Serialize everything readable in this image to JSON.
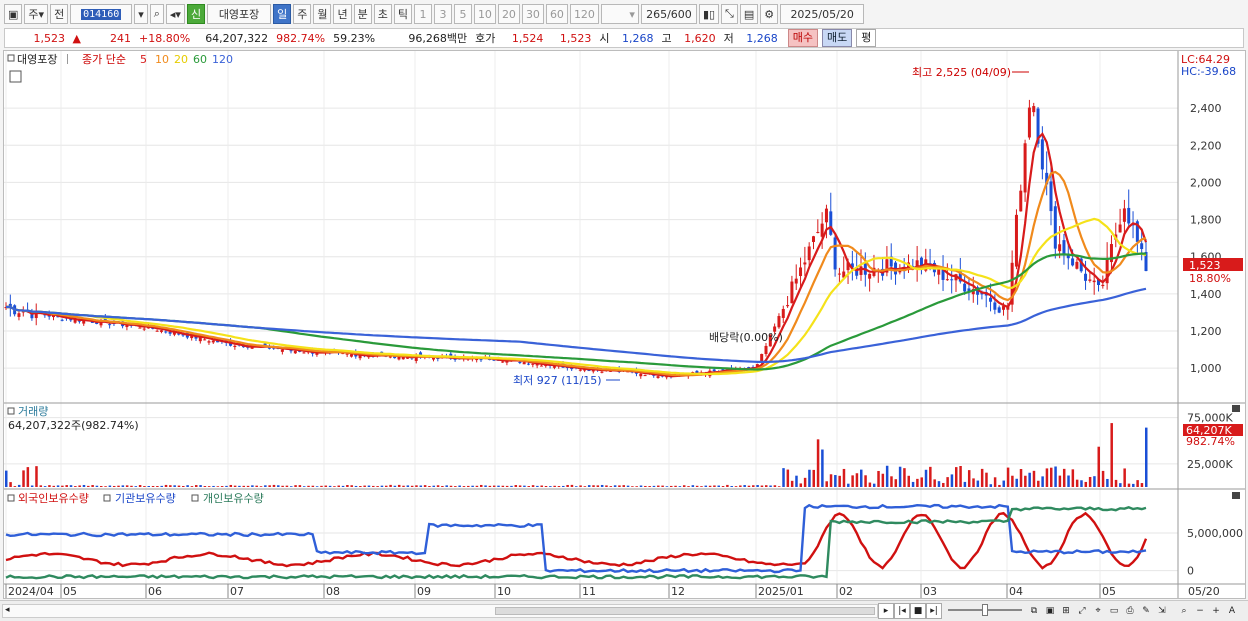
{
  "toolbar": {
    "kind": "주",
    "prev": "전",
    "code": "014160",
    "badge": "신",
    "name": "대영포장",
    "periods": [
      "일",
      "주",
      "월",
      "년",
      "분",
      "초",
      "틱"
    ],
    "minutes": [
      "1",
      "3",
      "5",
      "10",
      "20",
      "30",
      "60",
      "120"
    ],
    "count": "265",
    "total": "/600",
    "date": "2025/05/20"
  },
  "quote": {
    "price": "1,523",
    "change": "241",
    "rate": "+18.80%",
    "volume": "64,207,322",
    "vol_ratio": "982.74%",
    "turnover": "59.23%",
    "amount": "96,268백만",
    "ask_label": "호가",
    "ask1": "1,524",
    "ask2": "1,523",
    "open_label": "시",
    "open": "1,268",
    "high_label": "고",
    "high": "1,620",
    "low_label": "저",
    "low": "1,268",
    "buy": "매수",
    "sell": "매도",
    "eval": "평"
  },
  "price_panel": {
    "name": "대영포장",
    "ma_label": "종가 단순",
    "ma_periods": [
      "5",
      "10",
      "20",
      "60",
      "120"
    ],
    "lc": "LC:64.29",
    "hc": "HC:-39.68",
    "y_ticks": [
      "2,400",
      "2,200",
      "2,000",
      "1,800",
      "1,600",
      "1,400",
      "1,200",
      "1,000"
    ],
    "price_tag": "1,523",
    "rate_tag": "18.80%",
    "high_note": "최고 2,525 (04/09)",
    "low_note": "최저 927 (11/15)",
    "div_note": "배당락(0.00%)"
  },
  "volume_panel": {
    "label": "거래량",
    "value": "64,207,322주(982.74%)",
    "y_ticks": [
      "75,000K",
      "25,000K"
    ],
    "tag": "64,207K",
    "tag2": "982.74%"
  },
  "holdings_panel": {
    "labels": [
      "외국인보유수량",
      "기관보유수량",
      "개인보유수량"
    ],
    "y_ticks": [
      "5,000,000",
      "0"
    ]
  },
  "x_axis": [
    "2024/04",
    "05",
    "06",
    "07",
    "08",
    "09",
    "10",
    "11",
    "12",
    "2025/01",
    "02",
    "03",
    "04",
    "05",
    "05/20"
  ],
  "colors": {
    "ma5": "#d81b1b",
    "ma10": "#f08a1c",
    "ma20": "#f5e21a",
    "ma60": "#2a9a3a",
    "ma120": "#3a62d8",
    "up": "#d81b1b",
    "down": "#1a4fd6"
  },
  "chart_data": {
    "type": "candlestick",
    "ylim": [
      850,
      2600
    ],
    "price_path": [
      [
        "2024/04",
        1330
      ],
      [
        "05",
        1270
      ],
      [
        "06",
        1220
      ],
      [
        "07",
        1130
      ],
      [
        "08",
        1080
      ],
      [
        "09",
        1060
      ],
      [
        "10",
        1050
      ],
      [
        "11",
        1000
      ],
      [
        "12",
        960
      ],
      [
        "2025/01",
        1000
      ],
      [
        "01/20",
        1830
      ],
      [
        "02",
        1520
      ],
      [
        "03",
        1560
      ],
      [
        "03/20",
        1400
      ],
      [
        "04",
        1300
      ],
      [
        "04/09",
        2525
      ],
      [
        "04/20",
        1700
      ],
      [
        "05",
        1400
      ],
      [
        "05/10",
        1900
      ],
      [
        "05/20",
        1523
      ]
    ],
    "ma_periods": [
      5,
      10,
      20,
      60,
      120
    ],
    "volume_ylim": [
      0,
      80000
    ],
    "holdings_ylim": [
      -1500000,
      9500000
    ]
  }
}
